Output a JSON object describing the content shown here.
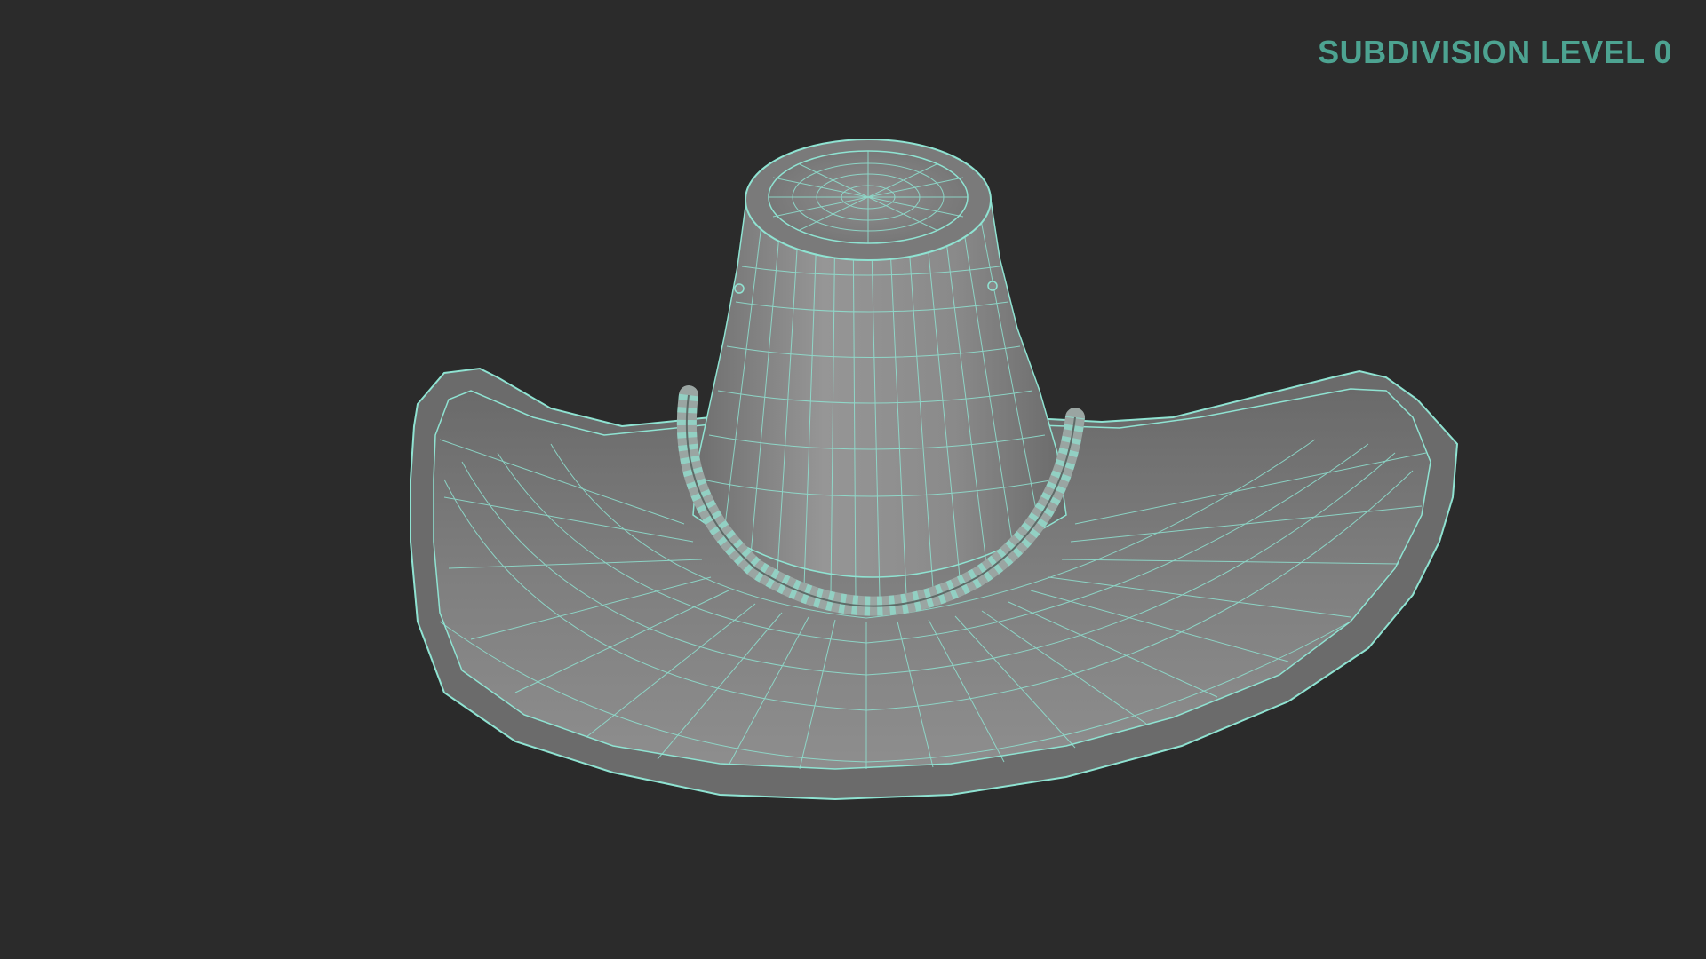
{
  "label": {
    "text": "SUBDIVISION LEVEL 0"
  },
  "colors": {
    "background": "#2b2b2b",
    "label": "#4da391",
    "wireframe": "#8fe3d2",
    "surface_light": "#8c8c8c",
    "surface_dark": "#5e5e5e"
  },
  "model": {
    "name": "wide-brim hat",
    "display_mode": "wireframe on shaded"
  }
}
